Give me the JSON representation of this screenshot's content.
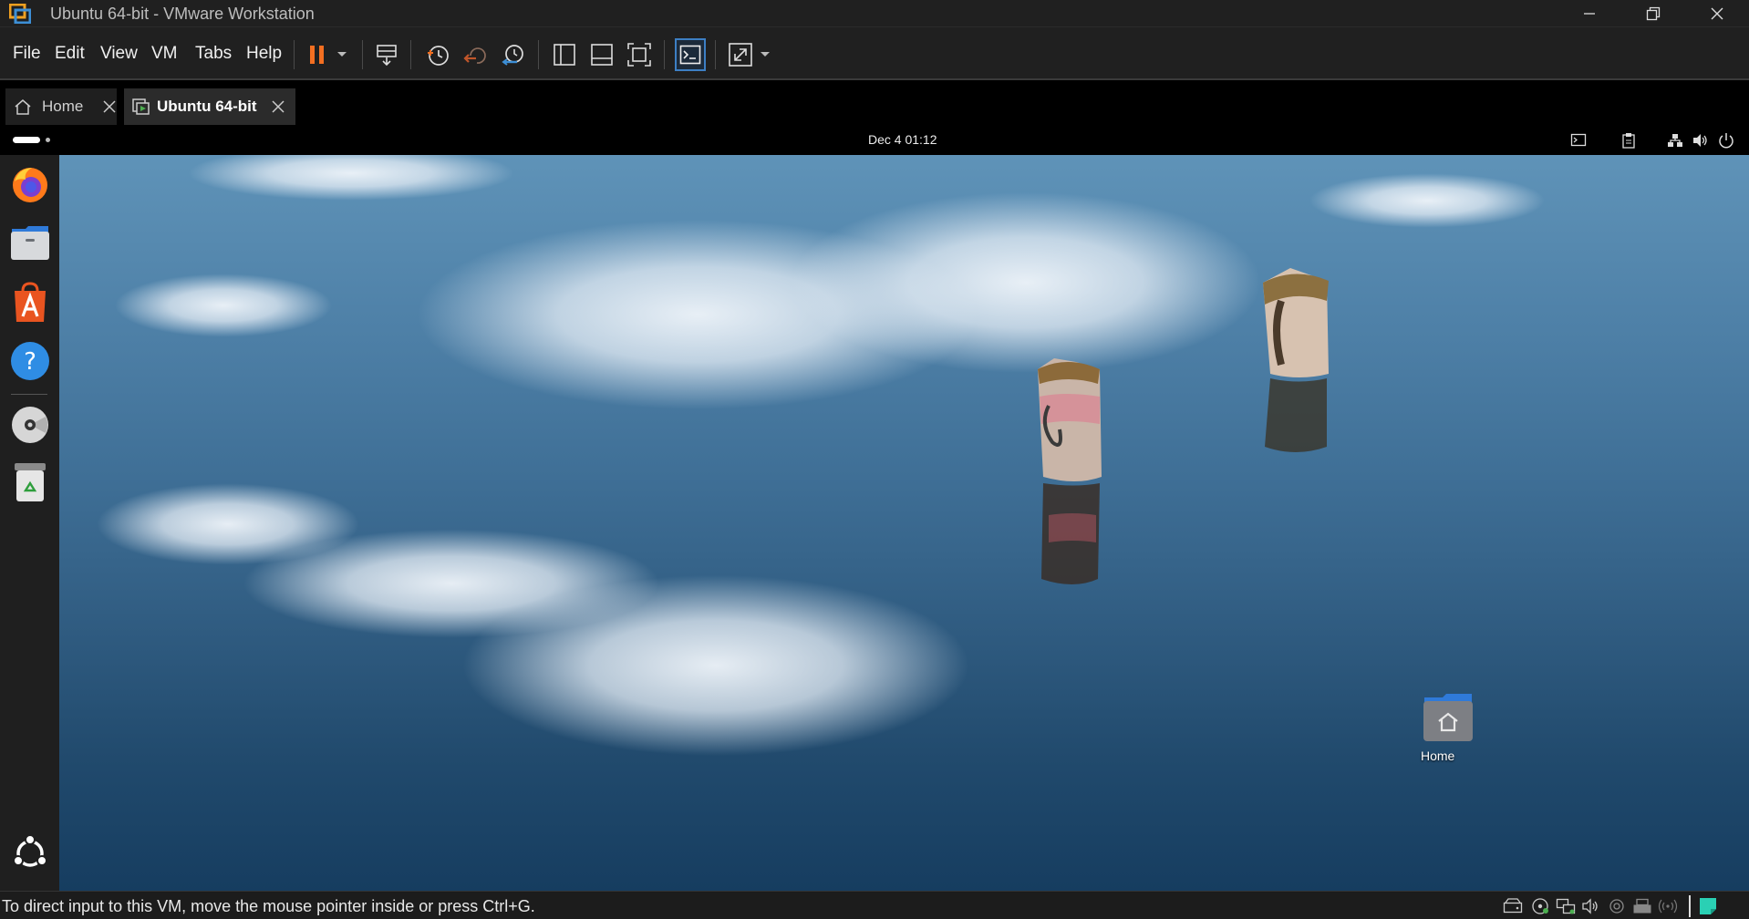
{
  "window": {
    "title": "Ubuntu 64-bit - VMware Workstation",
    "icons": [
      "vmware-logo-icon",
      "minimize-icon",
      "restore-icon",
      "close-icon"
    ]
  },
  "menu": {
    "items": [
      {
        "label": "File"
      },
      {
        "label": "Edit"
      },
      {
        "label": "View"
      },
      {
        "label": "VM"
      },
      {
        "label": "Tabs"
      },
      {
        "label": "Help"
      }
    ]
  },
  "toolbar": {
    "icons": [
      "pause-icon",
      "send-keys-icon",
      "snapshot-take-icon",
      "snapshot-revert-icon",
      "snapshot-manager-icon",
      "library-icon",
      "thumbnail-bar-icon",
      "full-screen-icon",
      "console-view-icon",
      "stretch-guest-icon"
    ],
    "accent": "#f36f21"
  },
  "tabs": [
    {
      "label": "Home",
      "active": false
    },
    {
      "label": "Ubuntu 64-bit",
      "active": true
    }
  ],
  "guest": {
    "clock": "Dec 4  01:12",
    "tray_icons": [
      "screen-icon",
      "clipboard-icon",
      "network-icon",
      "volume-icon",
      "power-icon"
    ],
    "dock": [
      "firefox-icon",
      "files-icon",
      "app-center-icon",
      "help-icon",
      "dvd-icon",
      "trash-icon",
      "show-apps-icon"
    ],
    "desktop_icon_label": "Home"
  },
  "statusbar": {
    "text": "To direct input to this VM, move the mouse pointer inside or press Ctrl+G.",
    "icons": [
      "hdd-icon",
      "cd-icon",
      "network-adapter-icon",
      "sound-icon",
      "usb-icon",
      "printer-icon",
      "wifi-icon",
      "notes-icon"
    ]
  }
}
